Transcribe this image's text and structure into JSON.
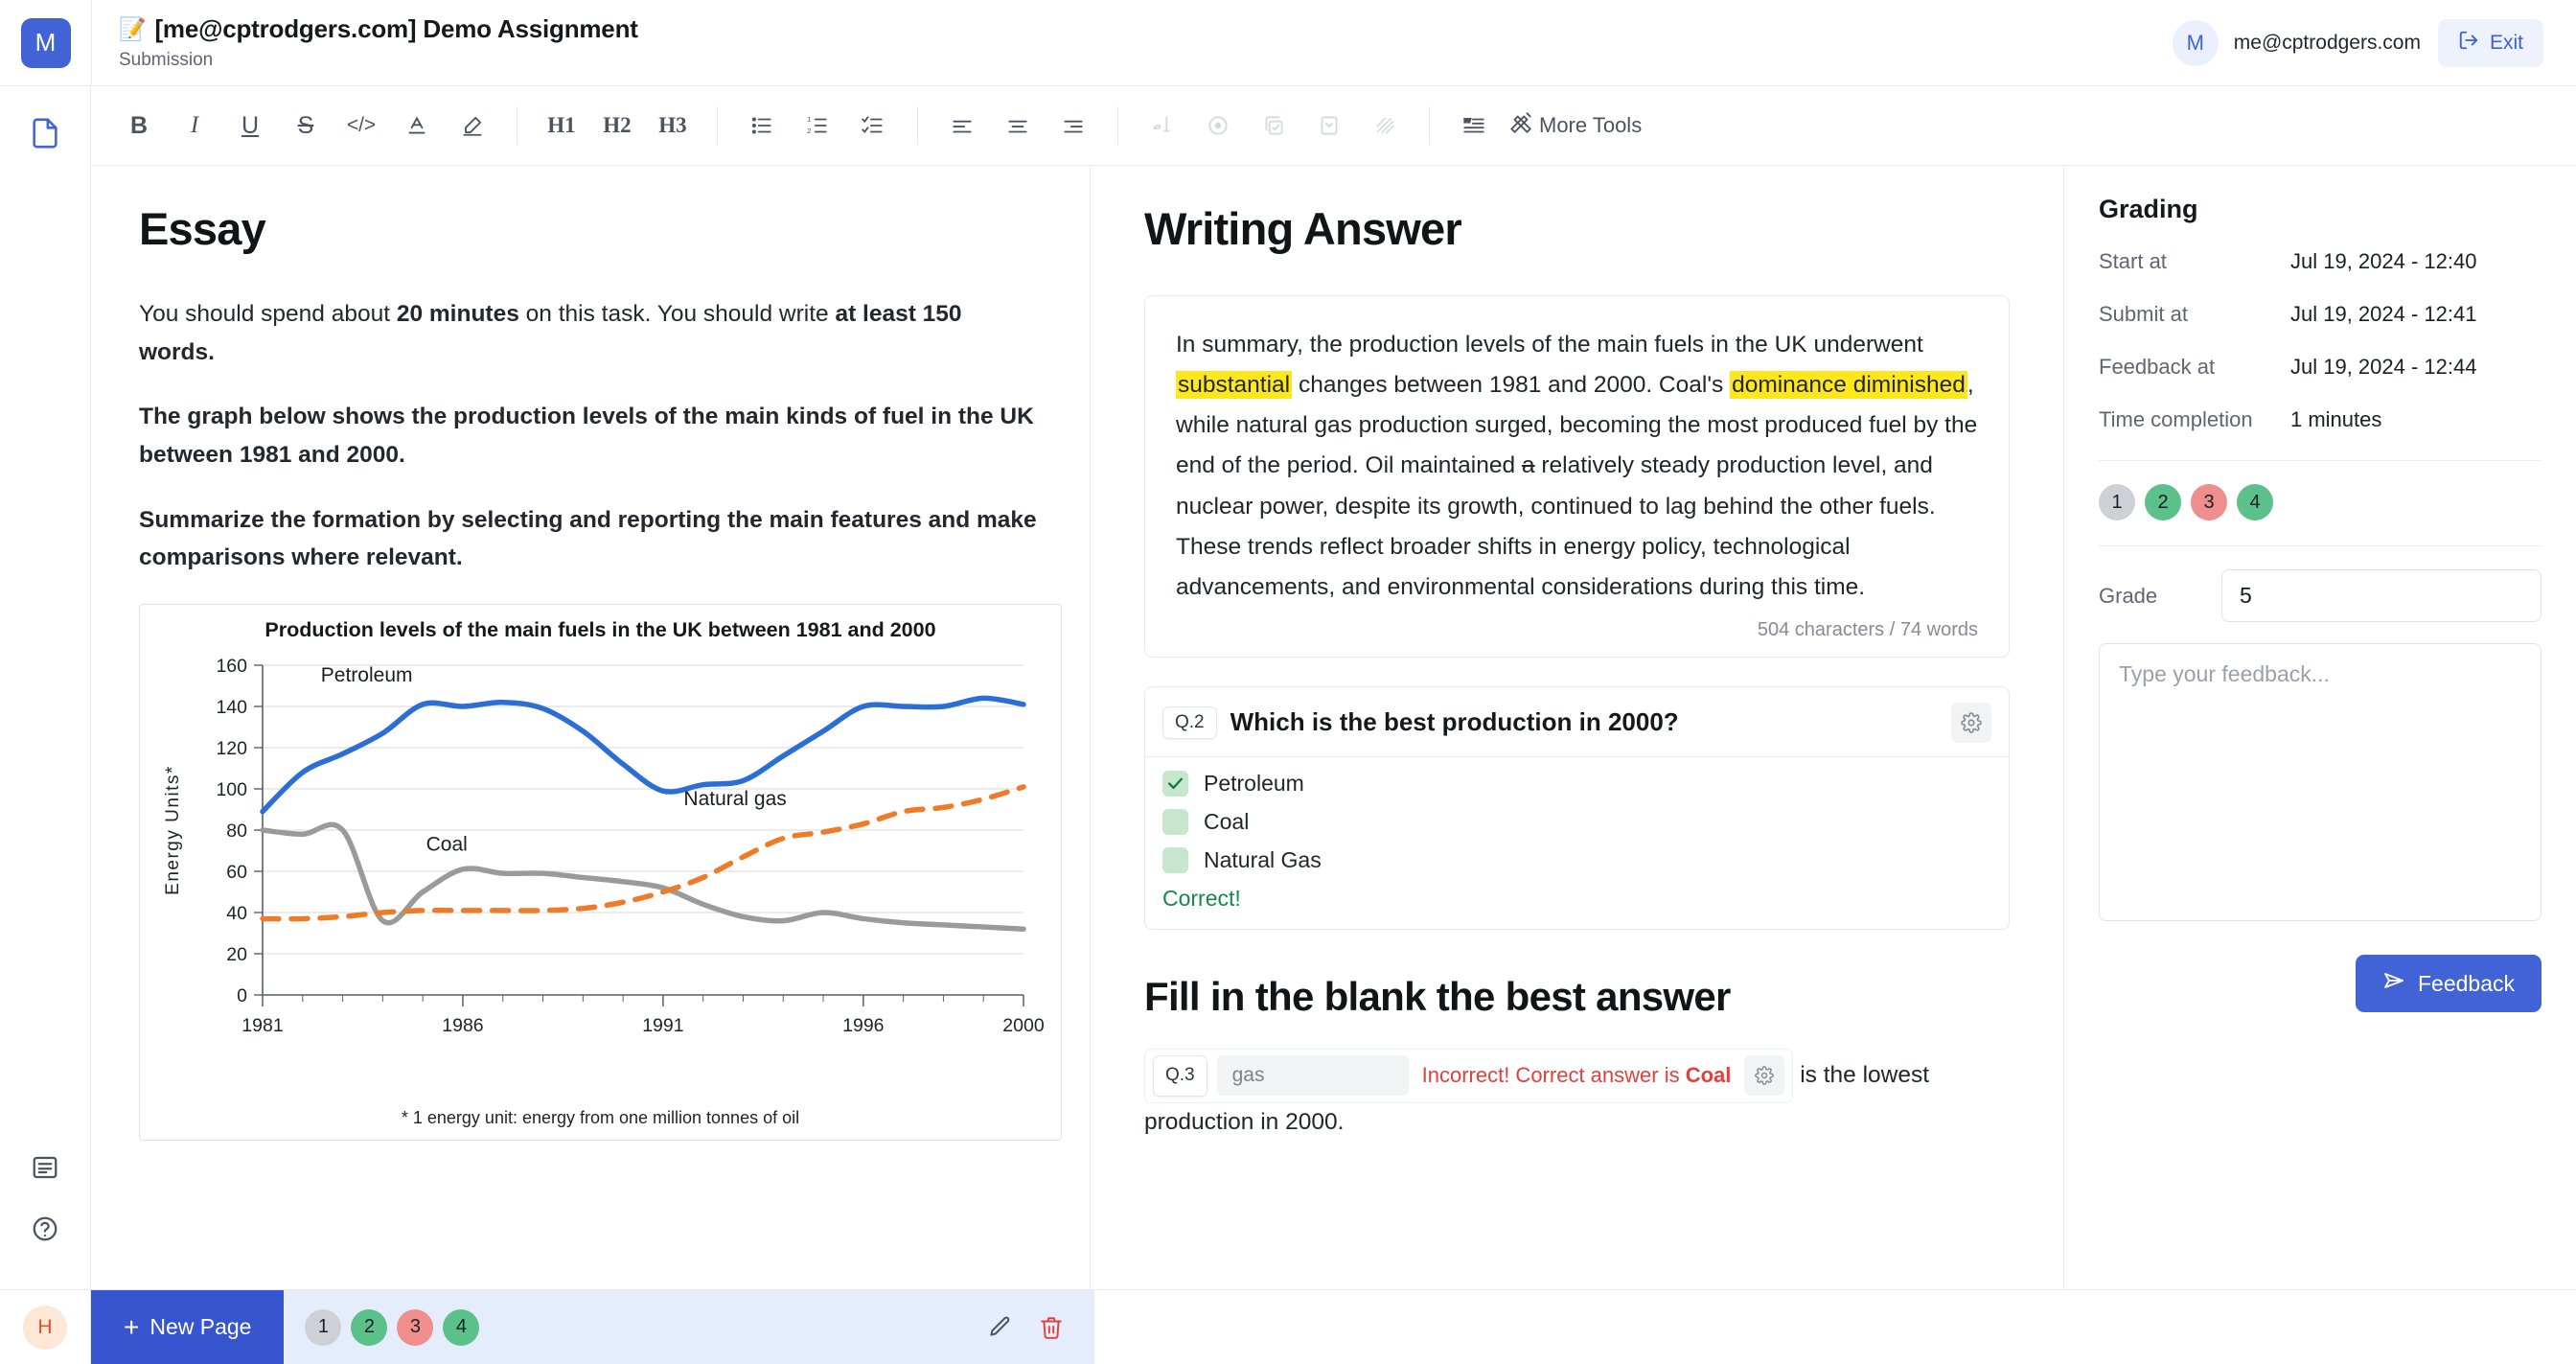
{
  "header": {
    "logo_initial": "M",
    "title_emoji": "📝",
    "title": "[me@cptrodgers.com] Demo Assignment",
    "subtitle": "Submission",
    "user_initial": "M",
    "user_email": "me@cptrodgers.com",
    "exit_label": "Exit"
  },
  "toolbar": {
    "bold": "B",
    "italic": "I",
    "underline": "U",
    "strike": "S",
    "code": "</>",
    "text_color": "A",
    "highlight": "highlighter",
    "h1": "H1",
    "h2": "H2",
    "h3": "H3",
    "more_tools": "More Tools"
  },
  "essay": {
    "title": "Essay",
    "paragraphs": [
      {
        "runs": [
          {
            "t": "You should spend about ",
            "b": false
          },
          {
            "t": "20 minutes",
            "b": true
          },
          {
            "t": " on this task. You should write ",
            "b": false
          },
          {
            "t": "at least 150 words.",
            "b": true
          }
        ]
      },
      {
        "runs": [
          {
            "t": "The graph below shows the production levels of the main kinds of fuel in the UK between 1981 and 2000.",
            "b": true
          }
        ]
      },
      {
        "runs": [
          {
            "t": "Summarize the formation by selecting and reporting the main features and make comparisons where relevant.",
            "b": true
          }
        ]
      }
    ]
  },
  "chart_data": {
    "type": "line",
    "title": "Production levels of the main fuels in the UK between 1981 and 2000",
    "footnote": "* 1 energy  unit: energy from one million tonnes of oil",
    "xlabel": "",
    "ylabel": "Energy Units*",
    "xlim": [
      1981,
      2000
    ],
    "ylim": [
      0,
      160
    ],
    "ytick_labels": [
      "0",
      "20",
      "40",
      "60",
      "80",
      "100",
      "120",
      "140",
      "160"
    ],
    "yticks": [
      0,
      20,
      40,
      60,
      80,
      100,
      120,
      140,
      160
    ],
    "xtick_labels": [
      "1981",
      "1986",
      "1991",
      "1996",
      "2000"
    ],
    "xticks": [
      1981,
      1986,
      1991,
      1996,
      2000
    ],
    "grid": true,
    "legend": "inline-annotations",
    "x": [
      1981,
      1982,
      1983,
      1984,
      1985,
      1986,
      1987,
      1988,
      1989,
      1990,
      1991,
      1992,
      1993,
      1994,
      1995,
      1996,
      1997,
      1998,
      1999,
      2000
    ],
    "series": [
      {
        "name": "Petroleum",
        "color": "#2b6fd6",
        "style": "solid",
        "label_pos": {
          "x": 1983.6,
          "y": 152
        },
        "values": [
          89,
          108,
          117,
          127,
          141,
          140,
          142,
          139,
          128,
          112,
          99,
          102,
          104,
          116,
          128,
          140,
          140,
          140,
          144,
          141
        ]
      },
      {
        "name": "Coal",
        "color": "#9a9a9a",
        "style": "solid",
        "label_pos": {
          "x": 1985.6,
          "y": 70
        },
        "values": [
          80,
          78,
          80,
          36,
          50,
          61,
          59,
          59,
          57,
          55,
          52,
          44,
          38,
          36,
          40,
          37,
          35,
          34,
          33,
          32
        ]
      },
      {
        "name": "Natural gas",
        "color": "#ef7b29",
        "style": "dashed",
        "label_pos": {
          "x": 1992.8,
          "y": 92
        },
        "values": [
          37,
          37,
          38,
          40,
          41,
          41,
          41,
          41,
          42,
          45,
          50,
          57,
          67,
          76,
          79,
          83,
          89,
          91,
          95,
          101
        ]
      }
    ]
  },
  "writing": {
    "title": "Writing Answer",
    "runs": [
      {
        "t": "In summary, the production levels of the main fuels in the UK underwent ",
        "hl": false,
        "sk": false
      },
      {
        "t": "substantial",
        "hl": true,
        "sk": false
      },
      {
        "t": " changes between 1981 and 2000. Coal's ",
        "hl": false,
        "sk": false
      },
      {
        "t": "dominance diminished",
        "hl": true,
        "sk": false
      },
      {
        "t": ", while natural gas production surged, becoming the most produced fuel by the end of the period. Oil maintained ",
        "hl": false,
        "sk": false
      },
      {
        "t": "a",
        "hl": false,
        "sk": true
      },
      {
        "t": " relatively steady production level, and nuclear power, despite its growth, continued to lag behind the other fuels. These trends reflect broader shifts in energy policy, technological advancements, and environmental considerations during this time.",
        "hl": false,
        "sk": false
      }
    ],
    "char_count": "504 characters / 74 words"
  },
  "question2": {
    "tag": "Q.2",
    "text": "Which is the best production in 2000?",
    "options": [
      {
        "label": "Petroleum",
        "checked": true
      },
      {
        "label": "Coal",
        "checked": false
      },
      {
        "label": "Natural Gas",
        "checked": false
      }
    ],
    "verdict": "Correct!"
  },
  "fill_blank": {
    "title": "Fill in the blank the best answer",
    "tag": "Q.3",
    "input_value": "gas",
    "message_prefix": "Incorrect! Correct answer is ",
    "message_answer": "Coal",
    "tail_text": " is the lowest production in 2000."
  },
  "grading": {
    "title": "Grading",
    "rows": [
      {
        "key": "Start at",
        "value": "Jul 19, 2024 - 12:40"
      },
      {
        "key": "Submit at",
        "value": "Jul 19, 2024 - 12:41"
      },
      {
        "key": "Feedback at",
        "value": "Jul 19, 2024 - 12:44"
      },
      {
        "key": "Time completion",
        "value": "1 minutes"
      }
    ],
    "badges": [
      {
        "n": "1",
        "color": "#cdd0d4"
      },
      {
        "n": "2",
        "color": "#5cc08a"
      },
      {
        "n": "3",
        "color": "#f08d8d"
      },
      {
        "n": "4",
        "color": "#5cc08a"
      }
    ],
    "grade_label": "Grade",
    "grade_value": "5",
    "feedback_placeholder": "Type your feedback...",
    "feedback_button": "Feedback"
  },
  "bottom": {
    "avatar_initial": "H",
    "new_page_label": "New Page",
    "badges": [
      {
        "n": "1",
        "color": "#cdd0d4"
      },
      {
        "n": "2",
        "color": "#5cc08a"
      },
      {
        "n": "3",
        "color": "#f08d8d"
      },
      {
        "n": "4",
        "color": "#5cc08a"
      }
    ]
  },
  "colors": {
    "brand_blue": "#4263d6",
    "highlight_yellow": "#ffe81a",
    "correct_green": "#138a4a",
    "error_red": "#e0413b"
  }
}
